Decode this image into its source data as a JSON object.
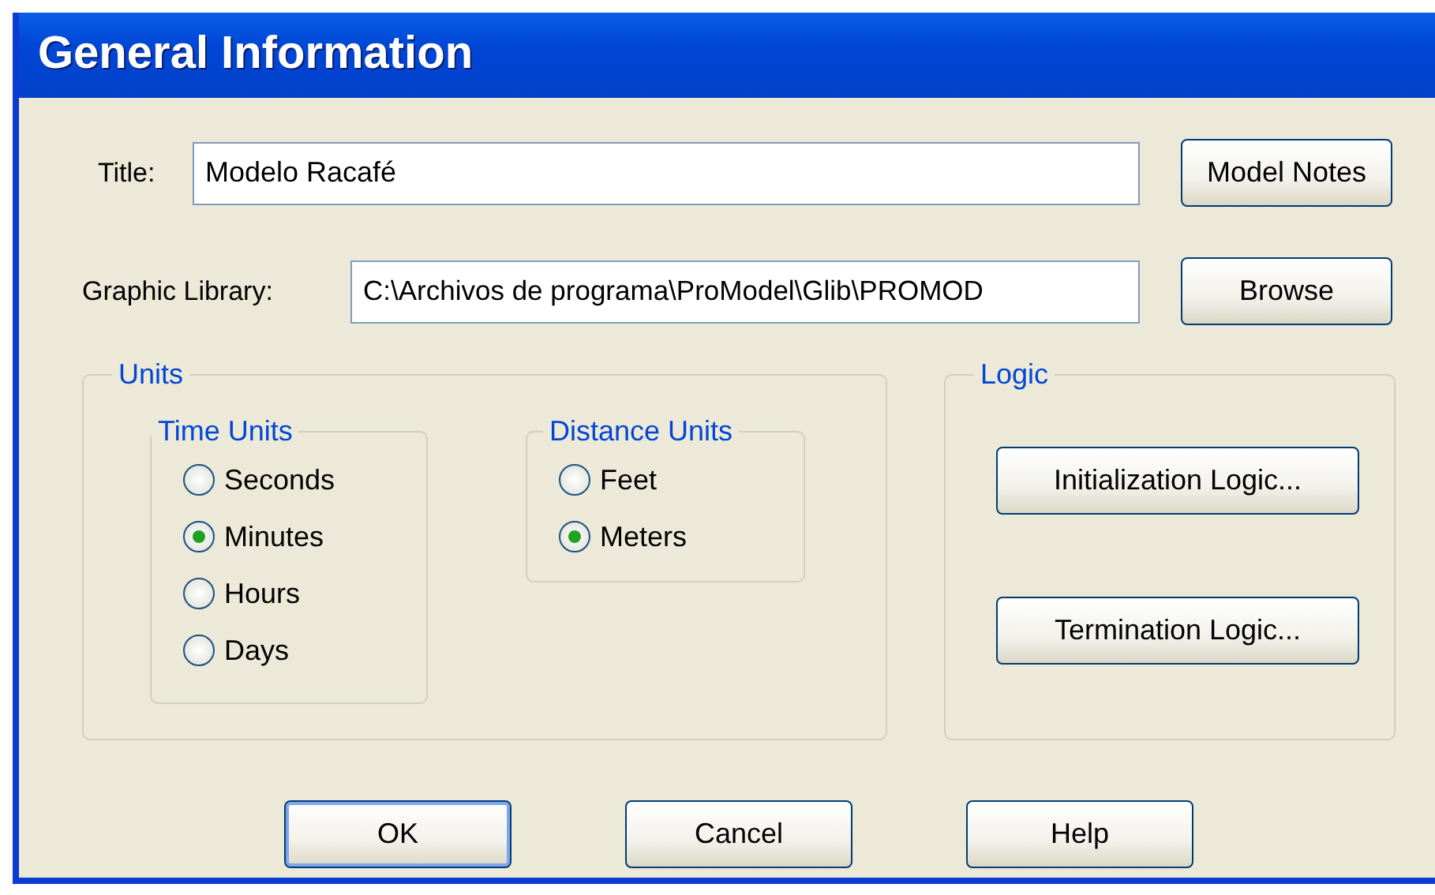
{
  "window": {
    "title": "General Information"
  },
  "title_field": {
    "label": "Title:",
    "value": "Modelo Racafé"
  },
  "model_notes_button": "Model Notes",
  "graphic_library_field": {
    "label": "Graphic Library:",
    "value": "C:\\Archivos de programa\\ProModel\\Glib\\PROMOD"
  },
  "browse_button": "Browse",
  "units": {
    "title": "Units",
    "time_units": {
      "title": "Time Units",
      "options": [
        {
          "label": "Seconds",
          "selected": false
        },
        {
          "label": "Minutes",
          "selected": true
        },
        {
          "label": "Hours",
          "selected": false
        },
        {
          "label": "Days",
          "selected": false
        }
      ]
    },
    "distance_units": {
      "title": "Distance Units",
      "options": [
        {
          "label": "Feet",
          "selected": false
        },
        {
          "label": "Meters",
          "selected": true
        }
      ]
    }
  },
  "logic": {
    "title": "Logic",
    "buttons": [
      "Initialization Logic...",
      "Termination Logic..."
    ]
  },
  "buttons": [
    {
      "label": "OK",
      "default": true
    },
    {
      "label": "Cancel",
      "default": false
    },
    {
      "label": "Help",
      "default": false
    }
  ]
}
